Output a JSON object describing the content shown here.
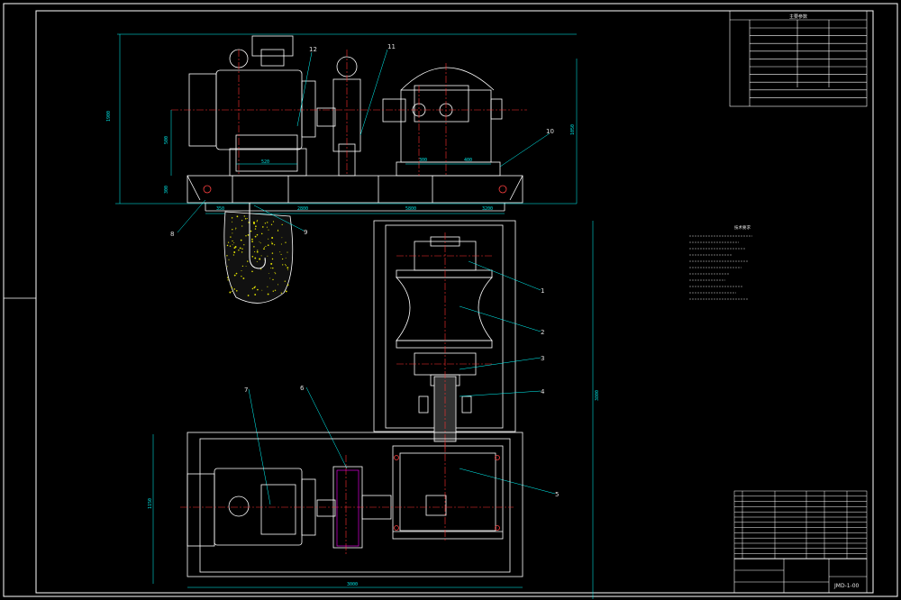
{
  "colors": {
    "background": "#000000",
    "frame": "#ffffff",
    "geometry": "#ffffff",
    "dimension": "#00ffff",
    "centerline": "#ff3030",
    "fill": "#e0e000",
    "hidden": "#ff00ff"
  },
  "tables": {
    "params_title": "主要参数",
    "spec_title": "技术要求"
  },
  "balloons": {
    "upper": [
      "12",
      "11",
      "10",
      "8",
      "9"
    ],
    "lower": [
      "1",
      "2",
      "3",
      "4",
      "5",
      "6",
      "7"
    ]
  },
  "dims": {
    "front_base": [
      "2800",
      "5800",
      "3200"
    ],
    "lower_total": "3000",
    "vertical_right": "3800"
  },
  "title_block": {
    "drawing_no": "JMD-1-00"
  }
}
